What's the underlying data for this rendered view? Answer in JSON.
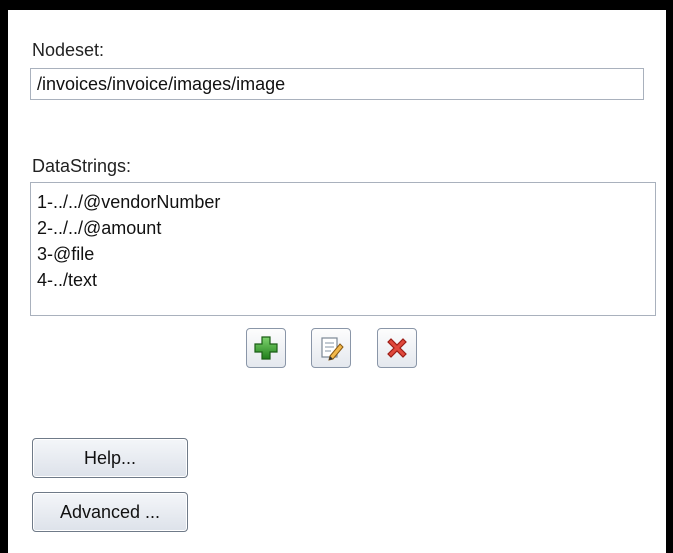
{
  "nodeset": {
    "label": "Nodeset:",
    "value": "/invoices/invoice/images/image"
  },
  "datastrings": {
    "label": "DataStrings:",
    "items": [
      "1-../../@vendorNumber",
      "2-../../@amount",
      "3-@file",
      "4-../text"
    ]
  },
  "toolbar": {
    "add_icon": "plus-icon",
    "edit_icon": "edit-icon",
    "delete_icon": "delete-x-icon"
  },
  "buttons": {
    "help_label": "Help...",
    "advanced_label": "Advanced ..."
  },
  "colors": {
    "add_green": "#2e9b26",
    "delete_red": "#d8342b",
    "border": "#a9b1bd"
  }
}
